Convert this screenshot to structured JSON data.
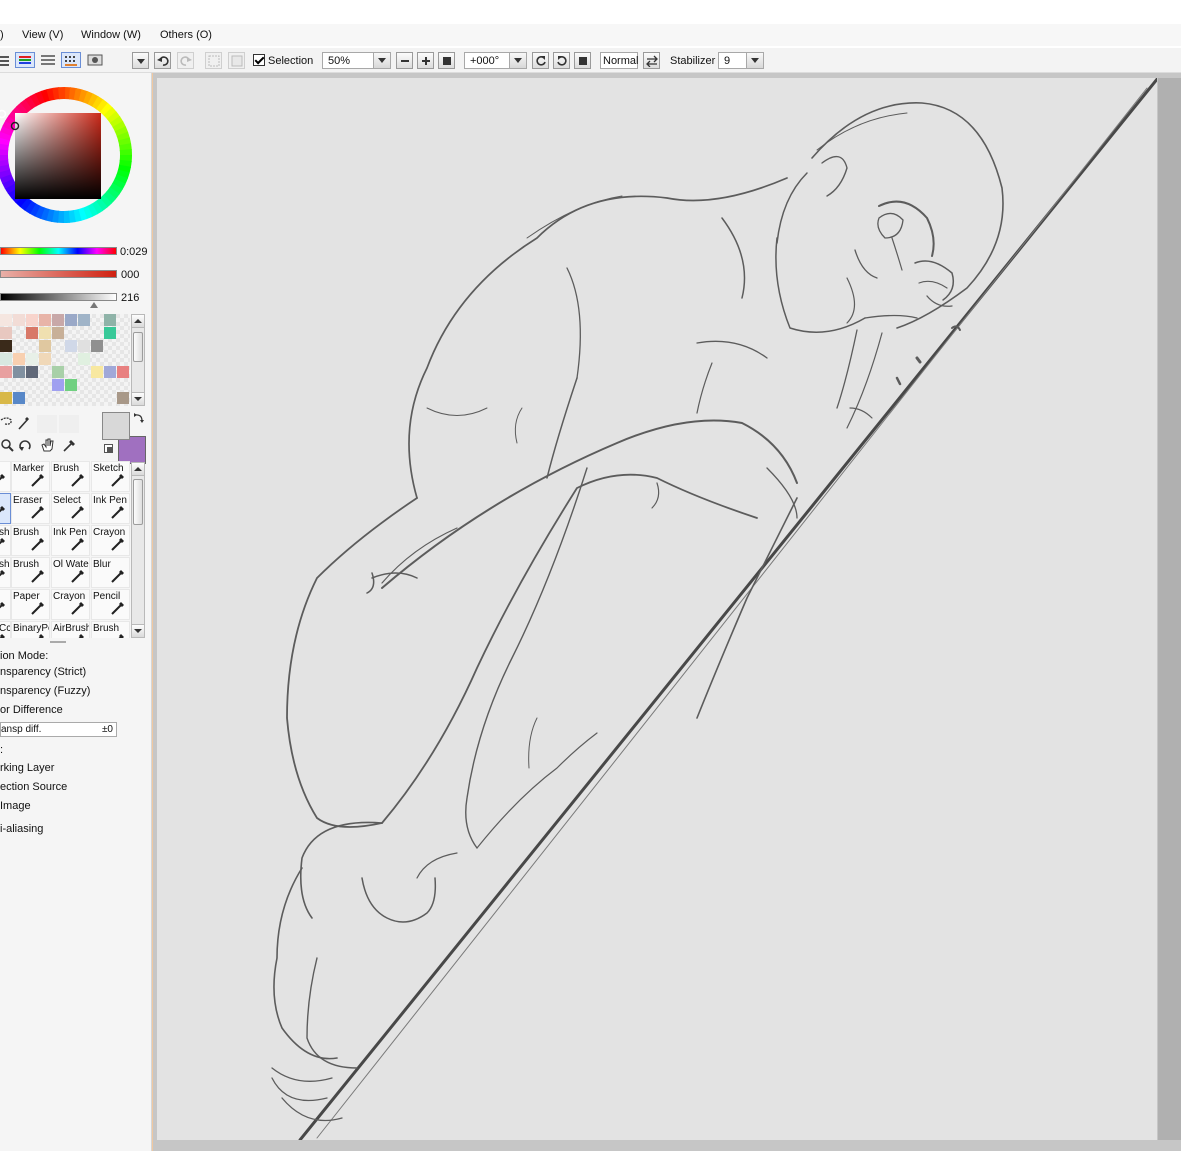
{
  "menu": {
    "items": [
      {
        "label": ")"
      },
      {
        "label": "View (V)"
      },
      {
        "label": "Window (W)"
      },
      {
        "label": "Others (O)"
      }
    ]
  },
  "toolbar": {
    "selection_label": "Selection",
    "selection_checked": true,
    "zoom_value": "50%",
    "rotation_value": "+000°",
    "blend_mode": "Normal",
    "stabilizer_label": "Stabilizer",
    "stabilizer_value": "9"
  },
  "color_panel": {
    "current_color": "#cc2a1a",
    "hue_value": "0:029",
    "saturation_value": "000",
    "value_value": "216",
    "swatches": [
      [
        "#f5e6e0",
        "#f2dcd6",
        "#f8d4cc",
        "#e8b4a8",
        "#c8a8a8",
        "#9aa9c8",
        "#a0b4c8",
        "#e8e8e8",
        "#8fb3a8",
        "#f0f0f0"
      ],
      [
        "#e8c8c0",
        "#f0f0f0",
        "#d87868",
        "#f0e0b0",
        "#c8b098",
        "#f0f0f0",
        "#f0f0f0",
        "#e8e8e8",
        "#38c898",
        "#f0f0f0"
      ],
      [
        "#3a2a1a",
        "#f0f0f0",
        "#f0f0f0",
        "#e0c8a0",
        "#f0f0f0",
        "#d0d8e8",
        "#e0e0e0",
        "#909090",
        "#f0f0f0",
        "#f0f0f0"
      ],
      [
        "#d8e8e0",
        "#f8d0b0",
        "#e8f0e8",
        "#f0d8b8",
        "#f0f0f0",
        "#f0f0f0",
        "#e0f0e0",
        "#f0f0f0",
        "#f0f0f0",
        "#f0f0f0"
      ],
      [
        "#e8a0a0",
        "#8090a0",
        "#606878",
        "#f0f0f0",
        "#a8d0a8",
        "#f0f0f0",
        "#f0f0f0",
        "#f8e8a0",
        "#a0a8d8",
        "#e88080"
      ],
      [
        "#f0f0f0",
        "#f0f0f0",
        "#f0f0f0",
        "#f0f0f0",
        "#a0a0f0",
        "#70d080",
        "#f0f0f0",
        "#f0f0f0",
        "#f0f0f0",
        "#f0f0f0"
      ],
      [
        "#d8b848",
        "#5888c8",
        "#f0f0f0",
        "#f8f0f0",
        "#f0f0f0",
        "#f0f0f0",
        "#f0f0f0",
        "#f0f0f0",
        "#f0f0f0",
        "#a89888"
      ]
    ],
    "primary_color": "#d8d8d8",
    "secondary_color": "#a070c0"
  },
  "tools": [
    [
      "",
      "Marker",
      "Brush",
      "Sketch"
    ],
    [
      "",
      "Eraser",
      "Select",
      "Ink Pen"
    ],
    [
      "sh",
      "Brush",
      "Ink Pen",
      "Crayon"
    ],
    [
      "sh",
      "Brush",
      "Ol Wate",
      "Blur"
    ],
    [
      "",
      "Paper",
      "Crayon",
      "Pencil"
    ],
    [
      "Cc",
      "BinaryPe",
      "AirBrush",
      "Brush"
    ]
  ],
  "tool_options": {
    "mode_label": "ion Mode:",
    "opt1": "nsparency (Strict)",
    "opt2": "nsparency (Fuzzy)",
    "opt3": "or Difference",
    "diff_label": "ansp diff.",
    "diff_value": "±0",
    "colon": ":",
    "src1": "rking Layer",
    "src2": "ection Source",
    "src3": "Image",
    "aa": "i-aliasing"
  }
}
